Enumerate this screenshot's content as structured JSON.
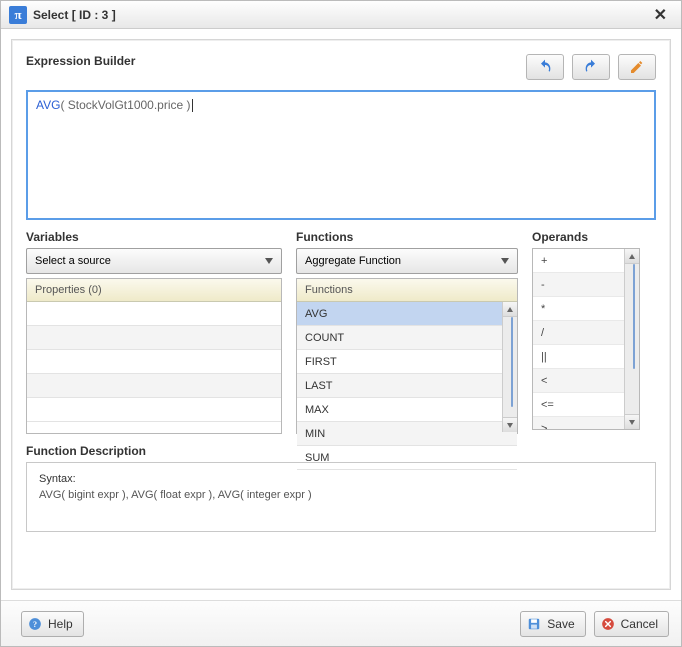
{
  "window": {
    "title": "Select [ ID : 3 ]"
  },
  "builder": {
    "title": "Expression Builder",
    "expression_fn": "AVG",
    "expression_arg": "( StockVolGt1000.price )"
  },
  "variables": {
    "title": "Variables",
    "dropdown": "Select a source",
    "header": "Properties (0)"
  },
  "functions": {
    "title": "Functions",
    "dropdown": "Aggregate Function",
    "header": "Functions",
    "items": [
      "AVG",
      "COUNT",
      "FIRST",
      "LAST",
      "MAX",
      "MIN",
      "SUM"
    ],
    "selected_index": 0
  },
  "operands": {
    "title": "Operands",
    "items": [
      "+",
      "-",
      "*",
      "/",
      "||",
      "<",
      "<=",
      ">"
    ]
  },
  "description": {
    "title": "Function Description",
    "syntax_label": "Syntax:",
    "syntax_text": "AVG( bigint expr ), AVG( float expr ), AVG( integer expr )"
  },
  "footer": {
    "help": "Help",
    "save": "Save",
    "cancel": "Cancel"
  }
}
